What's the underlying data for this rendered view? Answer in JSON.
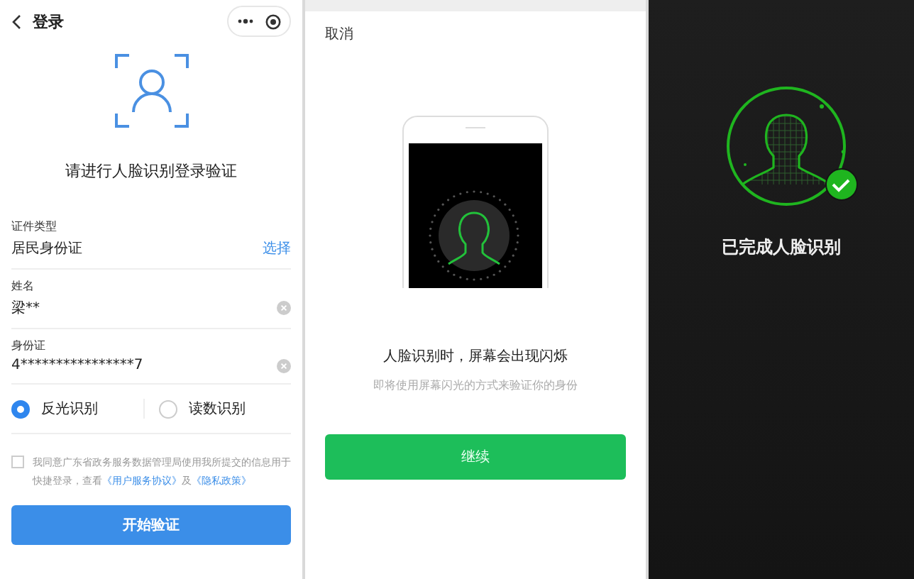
{
  "login_panel": {
    "header": {
      "title": "登录"
    },
    "heading": "请进行人脸识别登录验证",
    "fields": [
      {
        "kind": "select",
        "label": "证件类型",
        "value": "居民身份证",
        "action": "选择"
      },
      {
        "kind": "clearable",
        "label": "姓名",
        "value": "梁**"
      },
      {
        "kind": "clearable",
        "label": "身份证",
        "value": "4****************7"
      }
    ],
    "modes": [
      {
        "label": "反光识别",
        "selected": true
      },
      {
        "label": "读数识别",
        "selected": false
      }
    ],
    "agreement": {
      "checked": false,
      "segments": [
        {
          "kind": "text",
          "text": "我同意广东省政务服务数据管理局使用我所提交的信息用于快捷登录，查看"
        },
        {
          "kind": "link",
          "text": "《用户服务协议》"
        },
        {
          "kind": "text",
          "text": "及"
        },
        {
          "kind": "link",
          "text": "《隐私政策》"
        }
      ]
    },
    "submit": "开始验证"
  },
  "flash_panel": {
    "cancel": "取消",
    "title": "人脸识别时，屏幕会出现闪烁",
    "subtitle": "即将使用屏幕闪光的方式来验证你的身份",
    "continue": "继续"
  },
  "done_panel": {
    "message": "已完成人脸识别"
  }
}
